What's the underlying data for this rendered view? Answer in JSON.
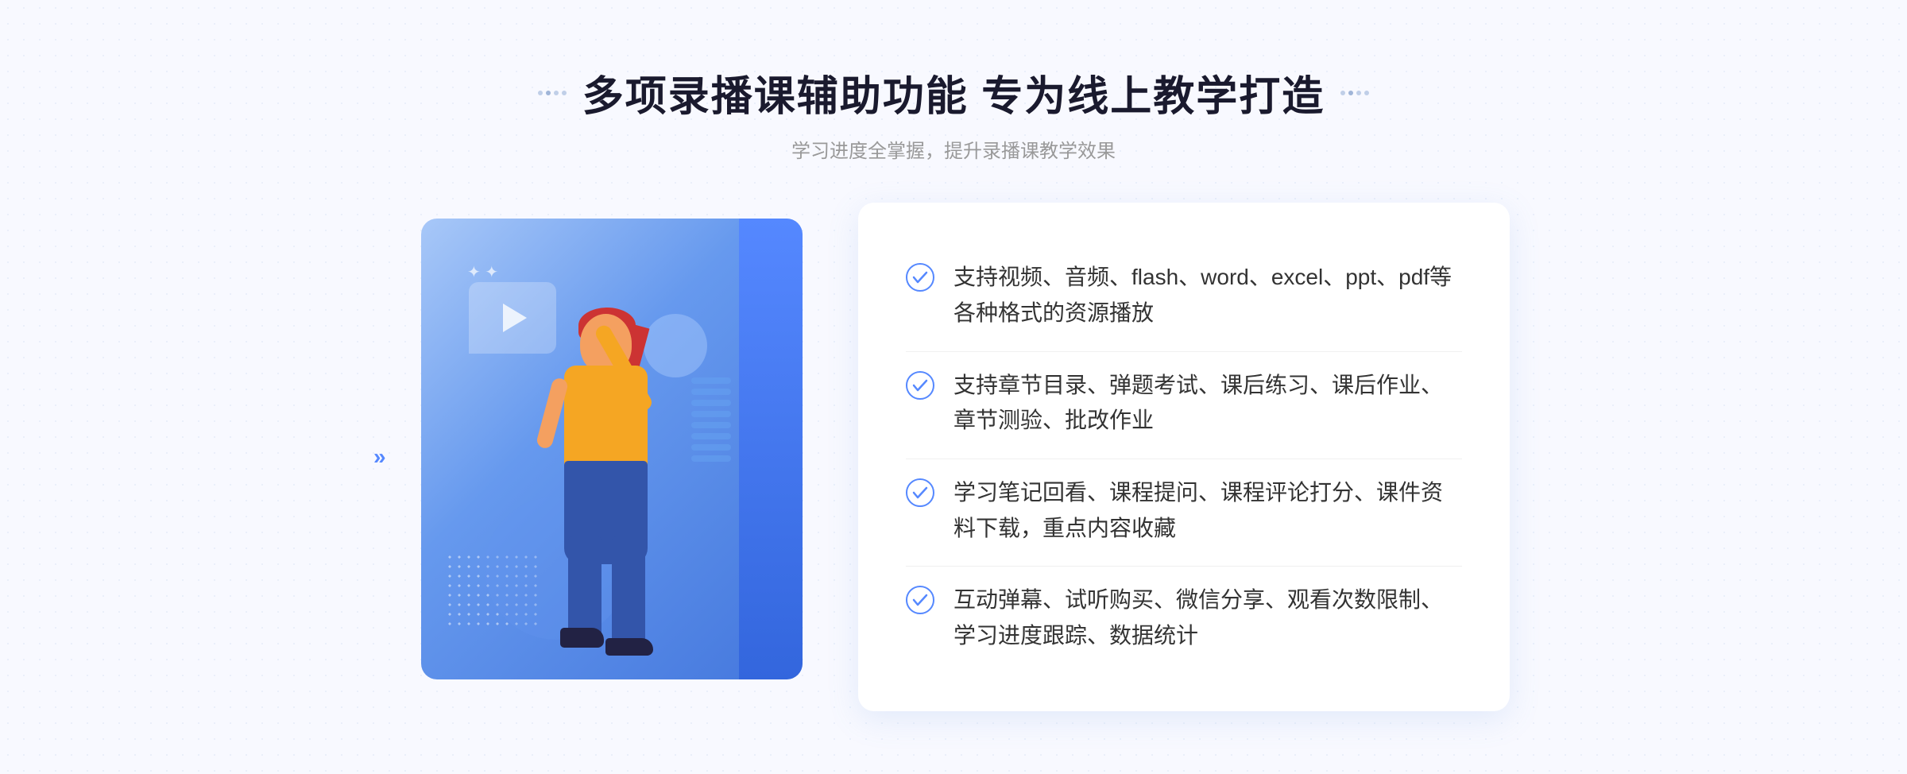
{
  "header": {
    "title": "多项录播课辅助功能 专为线上教学打造",
    "subtitle": "学习进度全掌握，提升录播课教学效果",
    "deco_dots": "decorative"
  },
  "features": [
    {
      "id": 1,
      "text": "支持视频、音频、flash、word、excel、ppt、pdf等各种格式的资源播放"
    },
    {
      "id": 2,
      "text": "支持章节目录、弹题考试、课后练习、课后作业、章节测验、批改作业"
    },
    {
      "id": 3,
      "text": "学习笔记回看、课程提问、课程评论打分、课件资料下载，重点内容收藏"
    },
    {
      "id": 4,
      "text": "互动弹幕、试听购买、微信分享、观看次数限制、学习进度跟踪、数据统计"
    }
  ],
  "illustration": {
    "alt": "person pointing illustration"
  },
  "chevrons": {
    "left": "»",
    "right": "»"
  },
  "colors": {
    "accent_blue": "#4477ee",
    "light_blue": "#a8c8f8",
    "check_color": "#5588ff"
  }
}
